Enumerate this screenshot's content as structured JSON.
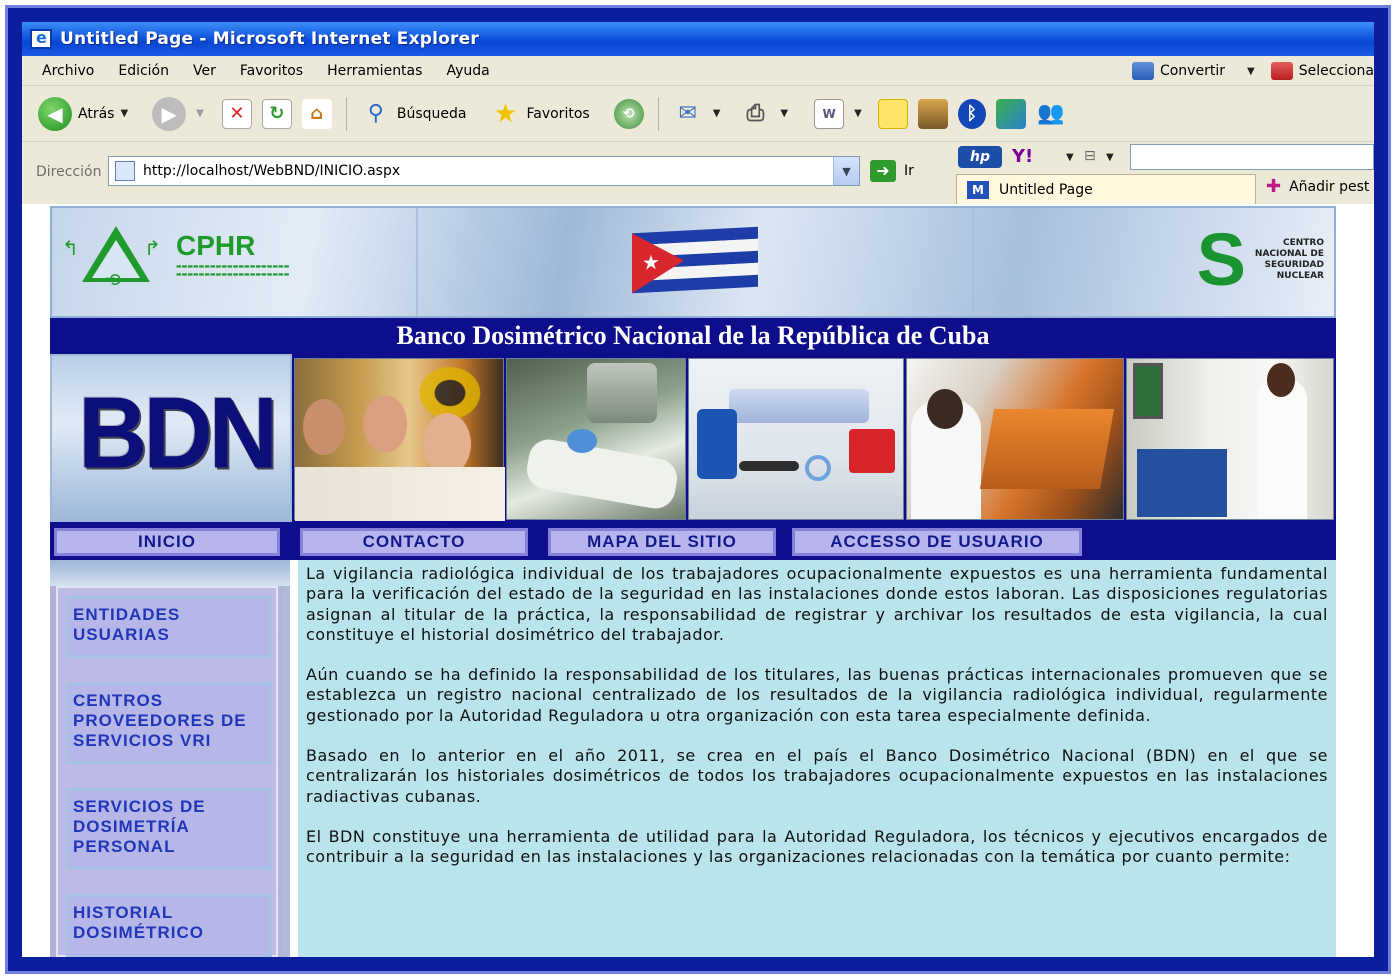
{
  "window": {
    "title": "Untitled Page - Microsoft Internet Explorer"
  },
  "menu": {
    "items": [
      "Archivo",
      "Edición",
      "Ver",
      "Favoritos",
      "Herramientas",
      "Ayuda"
    ],
    "convert_label": "Convertir",
    "select_label": "Selecciona"
  },
  "toolbar": {
    "back_label": "Atrás",
    "search_label": "Búsqueda",
    "favorites_label": "Favoritos"
  },
  "address": {
    "label": "Dirección",
    "url": "http://localhost/WebBND/INICIO.aspx",
    "go_label": "Ir"
  },
  "tabs": {
    "active_tab": "Untitled Page",
    "add_tab": "Añadir pest"
  },
  "page": {
    "banner": {
      "left_logo_text": "CPHR",
      "right_logo_text": "CENTRO NACIONAL DE SEGURIDAD NUCLEAR"
    },
    "headline": "Banco Dosimétrico Nacional de la República de Cuba",
    "bdn_logo": "BDN",
    "nav": [
      "INICIO",
      "CONTACTO",
      "MAPA DEL SITIO",
      "ACCESSO DE USUARIO"
    ],
    "sidebar": [
      "ENTIDADES USUARIAS",
      "CENTROS PROVEEDORES DE SERVICIOS VRI",
      "SERVICIOS DE DOSIMETRÍA PERSONAL",
      "HISTORIAL DOSIMÉTRICO"
    ],
    "paragraphs": [
      "La vigilancia radiológica individual de los trabajadores ocupacionalmente expuestos es una herramienta fundamental para la verificación del estado de la seguridad en las instalaciones donde estos laboran.  Las disposiciones regulatorias asignan al titular de la práctica, la responsabilidad de registrar y archivar los resultados de esta vigilancia, la cual  constituye el historial dosimétrico del trabajador.",
      "Aún cuando se ha definido la responsabilidad de los titulares, las buenas prácticas internacionales promueven que se establezca un registro nacional centralizado de los resultados de la vigilancia radiológica individual, regularmente gestionado por la Autoridad Reguladora u otra organización con esta tarea especialmente definida.",
      "Basado en lo anterior en el año 2011, se crea en el país el Banco Dosimétrico Nacional (BDN) en el que se centralizarán los historiales dosimétricos de todos los trabajadores ocupacionalmente expuestos en las instalaciones radiactivas cubanas.",
      "El BDN constituye una herramienta de utilidad para la Autoridad Reguladora, los técnicos y ejecutivos encargados de contribuir a la seguridad en las instalaciones y las organizaciones relacionadas con la temática por cuanto permite:"
    ]
  },
  "colors": {
    "frame_border": "#0b1f9e",
    "title_bar": "#0a46d3",
    "headline_bg": "#0e0e8c",
    "content_bg": "#b9e4ec",
    "nav_button_bg": "#b8b5ee",
    "sidebar_text": "#1f37b8"
  }
}
